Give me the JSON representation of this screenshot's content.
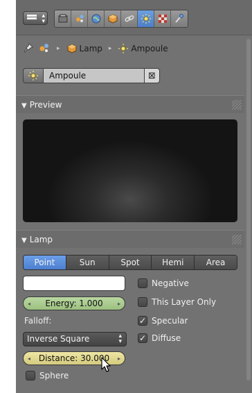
{
  "breadcrumb": {
    "items": [
      "Lamp",
      "Ampoule"
    ]
  },
  "datablock": {
    "name": "Ampoule"
  },
  "panels": {
    "preview": {
      "title": "Preview"
    },
    "lamp": {
      "title": "Lamp"
    }
  },
  "lamp": {
    "types": [
      "Point",
      "Sun",
      "Spot",
      "Hemi",
      "Area"
    ],
    "active_type": "Point",
    "color": "#ffffff",
    "energy_label": "Energy: 1.000",
    "falloff_label": "Falloff:",
    "falloff_value": "Inverse Square",
    "distance_label": "Distance: 30.000",
    "checks": {
      "negative": {
        "label": "Negative",
        "checked": false
      },
      "this_layer_only": {
        "label": "This Layer Only",
        "checked": false
      },
      "specular": {
        "label": "Specular",
        "checked": true
      },
      "diffuse": {
        "label": "Diffuse",
        "checked": true
      },
      "sphere": {
        "label": "Sphere",
        "checked": false
      }
    }
  },
  "colors": {
    "active_blue": "#5a8ee0",
    "energy_green": "#a8cc8c",
    "distance_yellow": "#e2d98f",
    "panel_bg": "#727272"
  },
  "icons": {
    "editor_type": "properties-editor-icon",
    "tabs": [
      "render-icon",
      "scene-icon",
      "world-icon",
      "object-icon",
      "constraints-icon",
      "object-data-lamp-icon",
      "texture-icon",
      "physics-icon"
    ],
    "active_tab": "object-data-lamp-icon"
  }
}
